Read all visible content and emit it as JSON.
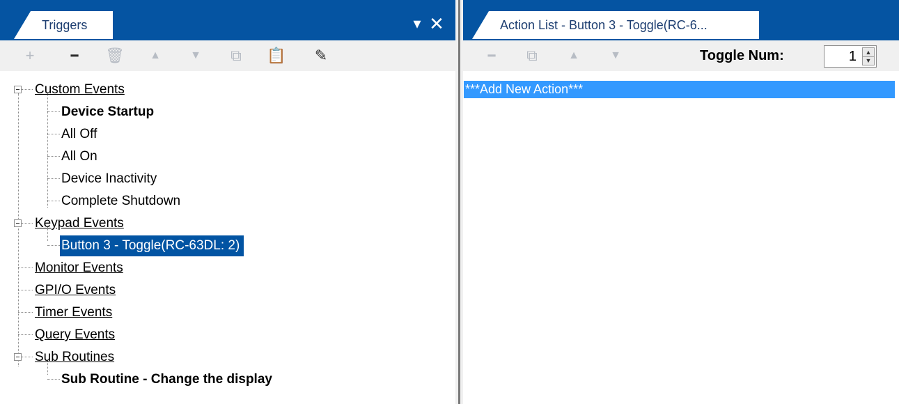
{
  "triggers_panel": {
    "tab_label": "Triggers",
    "header_buttons": [
      {
        "name": "pin-dropdown",
        "icon": "chevron-down-icon",
        "glyph": "▾"
      },
      {
        "name": "close",
        "icon": "close-icon",
        "glyph": "✕"
      }
    ],
    "toolbar": [
      {
        "name": "add",
        "icon": "plus-icon",
        "glyph": "+",
        "enabled": false
      },
      {
        "name": "remove",
        "icon": "minus-icon",
        "glyph": "━",
        "enabled": true
      },
      {
        "name": "delete",
        "icon": "trash-icon",
        "glyph": "🗑",
        "enabled": false
      },
      {
        "name": "move-up",
        "icon": "triangle-up-icon",
        "glyph": "▲",
        "enabled": false
      },
      {
        "name": "move-down",
        "icon": "triangle-down-icon",
        "glyph": "▼",
        "enabled": false
      },
      {
        "name": "copy",
        "icon": "copy-icon",
        "glyph": "⧉",
        "enabled": false
      },
      {
        "name": "paste",
        "icon": "clipboard-icon",
        "glyph": "📋",
        "enabled": false
      },
      {
        "name": "edit",
        "icon": "eraser-icon",
        "glyph": "✎",
        "enabled": true
      }
    ],
    "tree": {
      "custom_events": {
        "label": "Custom Events",
        "children": [
          "Device Startup",
          "All Off",
          "All On",
          "Device Inactivity",
          "Complete Shutdown"
        ]
      },
      "keypad_events": {
        "label": "Keypad Events",
        "children": [
          "Button 3 - Toggle(RC-63DL: 2)"
        ]
      },
      "monitor_events": {
        "label": "Monitor Events"
      },
      "gpio_events": {
        "label": "GPI/O Events"
      },
      "timer_events": {
        "label": "Timer Events"
      },
      "query_events": {
        "label": "Query Events"
      },
      "sub_routines": {
        "label": "Sub Routines",
        "children": [
          "Sub Routine - Change the display"
        ]
      }
    }
  },
  "action_panel": {
    "tab_label": "Action List - Button 3 - Toggle(RC-6...",
    "toolbar": [
      {
        "name": "remove",
        "icon": "minus-icon",
        "glyph": "━",
        "enabled": false
      },
      {
        "name": "copy",
        "icon": "copy-icon",
        "glyph": "⧉",
        "enabled": false
      },
      {
        "name": "move-up",
        "icon": "triangle-up-icon",
        "glyph": "▲",
        "enabled": false
      },
      {
        "name": "move-down",
        "icon": "triangle-down-icon",
        "glyph": "▼",
        "enabled": false
      }
    ],
    "toggle_num_label": "Toggle Num:",
    "toggle_num_value": "1",
    "actions": [
      "***Add New Action***"
    ]
  },
  "colors": {
    "header_blue": "#0554a2",
    "selection_blue": "#0254a3",
    "action_highlight": "#3399ff",
    "toolbar_bg": "#f0f0f0"
  }
}
